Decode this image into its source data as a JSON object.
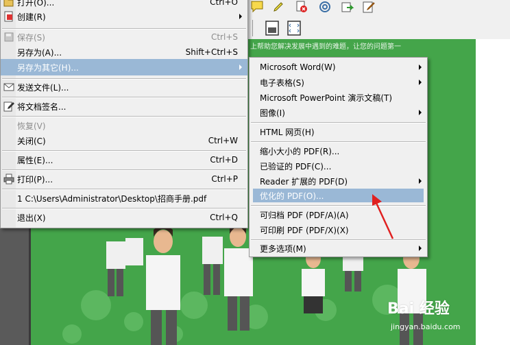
{
  "file_menu": {
    "items": [
      {
        "label": "打开(O)...",
        "shortcut": "Ctrl+O",
        "disabled": false,
        "submenu": false
      },
      {
        "label": "创建(R)",
        "shortcut": "",
        "disabled": false,
        "submenu": true
      },
      {
        "label": "保存(S)",
        "shortcut": "Ctrl+S",
        "disabled": true,
        "submenu": false
      },
      {
        "label": "另存为(A)...",
        "shortcut": "Shift+Ctrl+S",
        "disabled": false,
        "submenu": false
      },
      {
        "label": "另存为其它(H)...",
        "shortcut": "",
        "disabled": false,
        "submenu": true,
        "highlighted": true
      },
      {
        "label": "发送文件(L)...",
        "shortcut": "",
        "disabled": false,
        "submenu": false
      },
      {
        "label": "将文档签名...",
        "shortcut": "",
        "disabled": false,
        "submenu": false
      },
      {
        "label": "恢复(V)",
        "shortcut": "",
        "disabled": true,
        "submenu": false
      },
      {
        "label": "关闭(C)",
        "shortcut": "Ctrl+W",
        "disabled": false,
        "submenu": false
      },
      {
        "label": "属性(E)...",
        "shortcut": "Ctrl+D",
        "disabled": false,
        "submenu": false
      },
      {
        "label": "打印(P)...",
        "shortcut": "Ctrl+P",
        "disabled": false,
        "submenu": false
      },
      {
        "label": "1 C:\\Users\\Administrator\\Desktop\\招商手册.pdf",
        "shortcut": "",
        "disabled": false,
        "submenu": false
      },
      {
        "label": "退出(X)",
        "shortcut": "Ctrl+Q",
        "disabled": false,
        "submenu": false
      }
    ]
  },
  "save_as_other_menu": {
    "items": [
      {
        "label": "Microsoft Word(W)",
        "submenu": true
      },
      {
        "label": "电子表格(S)",
        "submenu": true
      },
      {
        "label": "Microsoft PowerPoint 演示文稿(T)",
        "submenu": false
      },
      {
        "label": "图像(I)",
        "submenu": true
      },
      {
        "label": "HTML 网页(H)",
        "submenu": false
      },
      {
        "label": "缩小大小的 PDF(R)...",
        "submenu": false
      },
      {
        "label": "已验证的 PDF(C)...",
        "submenu": false
      },
      {
        "label": "Reader 扩展的 PDF(D)",
        "submenu": true
      },
      {
        "label": "优化的 PDF(O)...",
        "submenu": false,
        "highlighted": true
      },
      {
        "label": "可归档 PDF (PDF/A)(A)",
        "submenu": false
      },
      {
        "label": "可印刷 PDF (PDF/X)(X)",
        "submenu": false
      },
      {
        "label": "更多选项(M)",
        "submenu": true
      }
    ]
  },
  "document": {
    "top_text": "上帮助您解决发展中遇到的难题，让您的问题第一"
  },
  "watermark": {
    "brand": "Bai 经验",
    "url": "jingyan.baidu.com"
  },
  "colors": {
    "menu_bg": "#f0f0f0",
    "highlight": "#9ab8d6",
    "doc_green": "#44a54a",
    "arrow_red": "#e02020"
  }
}
